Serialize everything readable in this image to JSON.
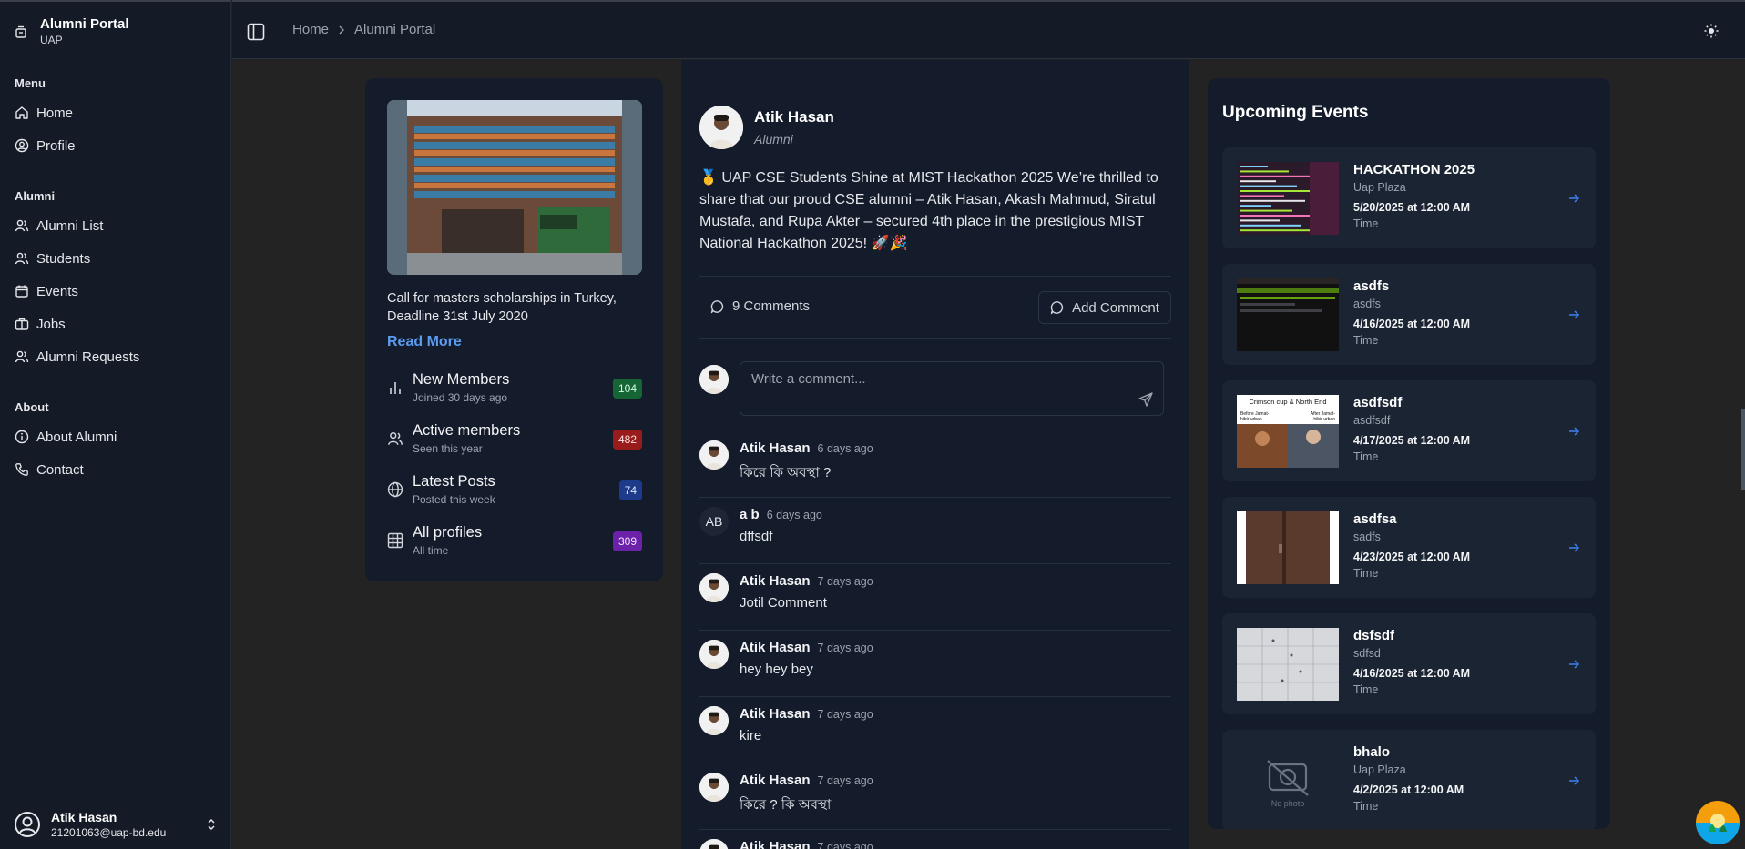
{
  "app": {
    "title": "Alumni Portal",
    "subtitle": "UAP"
  },
  "sidebar": {
    "menu_label": "Menu",
    "menu": [
      {
        "label": "Home",
        "icon": "home-icon"
      },
      {
        "label": "Profile",
        "icon": "user-circle-icon"
      }
    ],
    "alumni_label": "Alumni",
    "alumni": [
      {
        "label": "Alumni List",
        "icon": "users-icon"
      },
      {
        "label": "Students",
        "icon": "users-icon"
      },
      {
        "label": "Events",
        "icon": "calendar-icon"
      },
      {
        "label": "Jobs",
        "icon": "briefcase-icon"
      },
      {
        "label": "Alumni Requests",
        "icon": "users-icon"
      }
    ],
    "about_label": "About",
    "about": [
      {
        "label": "About Alumni",
        "icon": "info-icon"
      },
      {
        "label": "Contact",
        "icon": "phone-icon"
      }
    ],
    "user": {
      "name": "Atik Hasan",
      "email": "21201063@uap-bd.edu"
    }
  },
  "breadcrumb": {
    "home": "Home",
    "current": "Alumni Portal"
  },
  "left_card": {
    "description": "Call for masters scholarships in Turkey, Deadline 31st July 2020",
    "read_more": "Read More",
    "stats": [
      {
        "label": "New Members",
        "sub": "Joined 30 days ago",
        "value": "104",
        "color": "#166534"
      },
      {
        "label": "Active members",
        "sub": "Seen this year",
        "value": "482",
        "color": "#991b1b"
      },
      {
        "label": "Latest Posts",
        "sub": "Posted this week",
        "value": "74",
        "color": "#1e3a8a"
      },
      {
        "label": "All profiles",
        "sub": "All time",
        "value": "309",
        "color": "#6b21a8"
      }
    ]
  },
  "post": {
    "author": "Atik Hasan",
    "role": "Alumni",
    "body": "🥇 UAP CSE Students Shine at MIST Hackathon 2025 We’re thrilled to share that our proud CSE alumni – Atik Hasan, Akash Mahmud, Siratul Mustafa, and Rupa Akter – secured 4th place in the prestigious MIST National Hackathon 2025! 🚀🎉",
    "comments_label": "9 Comments",
    "add_comment_label": "Add Comment",
    "comment_placeholder": "Write a comment...",
    "comments": [
      {
        "author": "Atik Hasan",
        "time": "6 days ago",
        "text": "কিরে কি অবস্থা ?",
        "initials": ""
      },
      {
        "author": "a b",
        "time": "6 days ago",
        "text": "dffsdf",
        "initials": "AB"
      },
      {
        "author": "Atik Hasan",
        "time": "7 days ago",
        "text": "Jotil Comment",
        "initials": ""
      },
      {
        "author": "Atik Hasan",
        "time": "7 days ago",
        "text": "hey hey bey",
        "initials": ""
      },
      {
        "author": "Atik Hasan",
        "time": "7 days ago",
        "text": "kire",
        "initials": ""
      },
      {
        "author": "Atik Hasan",
        "time": "7 days ago",
        "text": "কিরে ? কি অবস্থা",
        "initials": ""
      },
      {
        "author": "Atik Hasan",
        "time": "7 days ago",
        "text": "",
        "initials": ""
      }
    ]
  },
  "events": {
    "title": "Upcoming Events",
    "items": [
      {
        "title": "HACKATHON 2025",
        "location": "Uap Plaza",
        "date": "5/20/2025 at 12:00 AM",
        "time_label": "Time",
        "thumb": "code"
      },
      {
        "title": "asdfs",
        "location": "asdfs",
        "date": "4/16/2025 at 12:00 AM",
        "time_label": "Time",
        "thumb": "terminal"
      },
      {
        "title": "asdfsdf",
        "location": "asdfsdf",
        "date": "4/17/2025 at 12:00 AM",
        "time_label": "Time",
        "thumb": "poster"
      },
      {
        "title": "asdfsa",
        "location": "sadfs",
        "date": "4/23/2025 at 12:00 AM",
        "time_label": "Time",
        "thumb": "door"
      },
      {
        "title": "dsfsdf",
        "location": "sdfsd",
        "date": "4/16/2025 at 12:00 AM",
        "time_label": "Time",
        "thumb": "paper"
      },
      {
        "title": "bhalo",
        "location": "Uap Plaza",
        "date": "4/2/2025 at 12:00 AM",
        "time_label": "Time",
        "thumb": "none"
      }
    ],
    "thumb_texts": {
      "poster_title": "Crimson cup & North End",
      "poster_left": "Before Jamat-Shibir urban",
      "poster_right": "After Jamat-Shibir urban",
      "no_photo": "No photo"
    }
  },
  "colors": {
    "accent": "#5b9cf0",
    "background": "#232323",
    "panel": "#141c2b"
  }
}
